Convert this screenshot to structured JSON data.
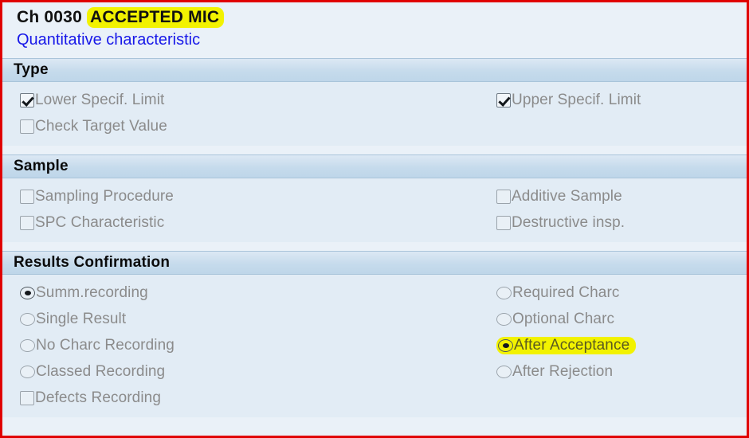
{
  "colors": {
    "frame_border": "#e00000",
    "highlight": "#f2f200",
    "subtitle": "#1818e8",
    "panel_bg": "#e2ecf5",
    "header_bg": "#c6dbec",
    "disabled_text": "#8b8b8b"
  },
  "header": {
    "characteristic_prefix": "Ch 0030",
    "characteristic_name": "ACCEPTED MIC",
    "subtitle": "Quantitative characteristic"
  },
  "sections": [
    {
      "title": "Type",
      "left": [
        {
          "control": "checkbox",
          "label": "Lower Specif. Limit",
          "checked": true,
          "highlighted": false
        },
        {
          "control": "checkbox",
          "label": "Check Target Value",
          "checked": false,
          "highlighted": false
        }
      ],
      "right": [
        {
          "control": "checkbox",
          "label": "Upper Specif. Limit",
          "checked": true,
          "highlighted": false
        }
      ]
    },
    {
      "title": "Sample",
      "left": [
        {
          "control": "checkbox",
          "label": "Sampling Procedure",
          "checked": false,
          "highlighted": false
        },
        {
          "control": "checkbox",
          "label": "SPC Characteristic",
          "checked": false,
          "highlighted": false
        }
      ],
      "right": [
        {
          "control": "checkbox",
          "label": "Additive Sample",
          "checked": false,
          "highlighted": false
        },
        {
          "control": "checkbox",
          "label": "Destructive insp.",
          "checked": false,
          "highlighted": false
        }
      ]
    },
    {
      "title": "Results Confirmation",
      "left": [
        {
          "control": "radio",
          "label": "Summ.recording",
          "checked": true,
          "highlighted": false
        },
        {
          "control": "radio",
          "label": "Single Result",
          "checked": false,
          "highlighted": false
        },
        {
          "control": "radio",
          "label": "No Charc Recording",
          "checked": false,
          "highlighted": false
        },
        {
          "control": "radio",
          "label": "Classed Recording",
          "checked": false,
          "highlighted": false
        },
        {
          "control": "checkbox",
          "label": "Defects Recording",
          "checked": false,
          "highlighted": false
        }
      ],
      "right": [
        {
          "control": "radio",
          "label": "Required Charc",
          "checked": false,
          "highlighted": false
        },
        {
          "control": "radio",
          "label": "Optional Charc",
          "checked": false,
          "highlighted": false
        },
        {
          "control": "radio",
          "label": "After Acceptance",
          "checked": true,
          "highlighted": true
        },
        {
          "control": "radio",
          "label": "After Rejection",
          "checked": false,
          "highlighted": false
        }
      ]
    }
  ]
}
